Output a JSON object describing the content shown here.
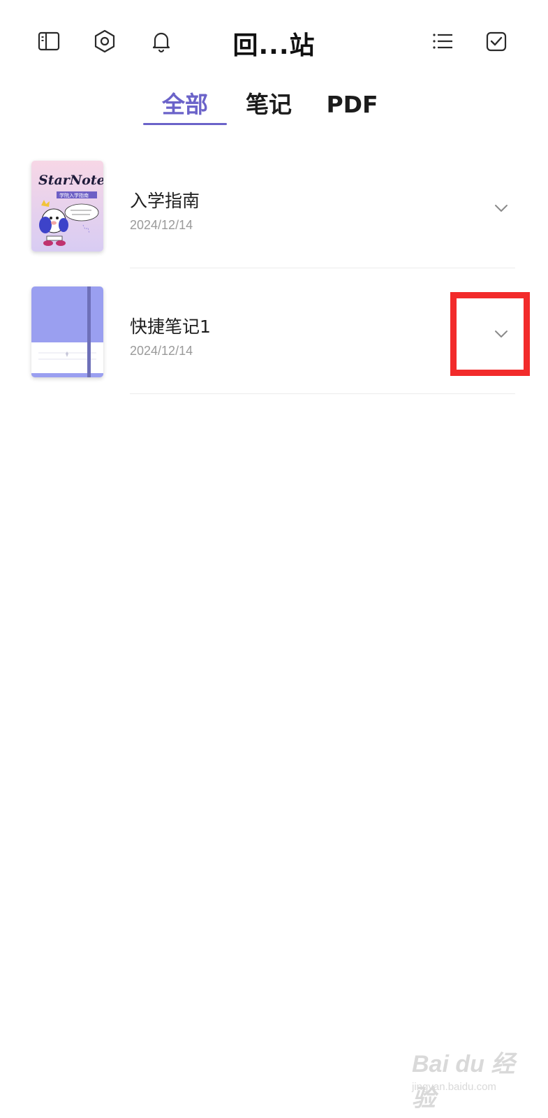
{
  "header": {
    "title": "回...站",
    "icons": [
      "sidebar-icon",
      "settings-icon",
      "bell-icon",
      "list-icon",
      "check-square-icon"
    ]
  },
  "tabs": [
    {
      "label": "全部",
      "active": true
    },
    {
      "label": "笔记",
      "active": false
    },
    {
      "label": "PDF",
      "active": false
    }
  ],
  "items": [
    {
      "title": "入学指南",
      "date": "2024/12/14",
      "cover": {
        "brand": "StarNote",
        "subtitle": "学院入学指南"
      }
    },
    {
      "title": "快捷笔记1",
      "date": "2024/12/14",
      "cover": {
        "color": "#9a9ff0"
      }
    }
  ],
  "watermark": {
    "main": "Bai du 经验",
    "sub": "jingyan.baidu.com"
  },
  "colors": {
    "accent": "#6b63c9",
    "highlight": "#f22b2b"
  }
}
